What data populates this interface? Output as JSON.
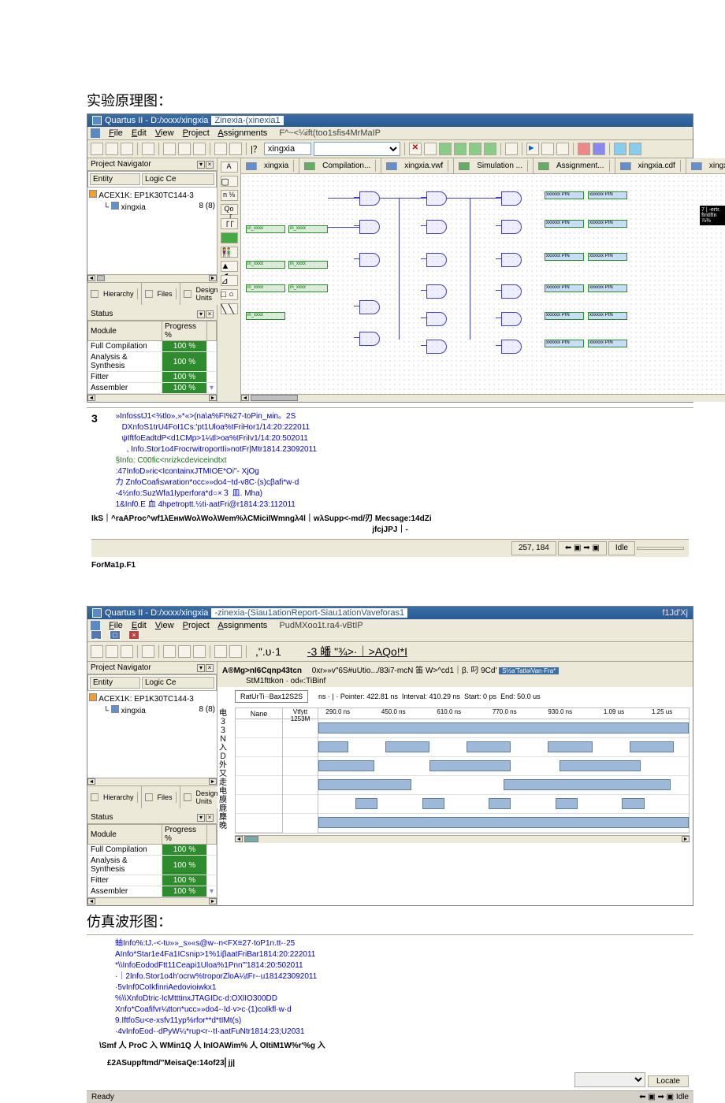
{
  "section1_title": "实验原理图：",
  "section2_title": "仿真波形图：",
  "app": {
    "title1": "Quartus II - D:/xxxx/xingxia",
    "subtitle1": "Zinexia-(xinexia1",
    "info1": "F^~<¼ift(too1sfis4MrMaIP",
    "title2": "Quartus II - D:/xxxx/xingxia",
    "subtitle2": "-zinexia-(Siau1ationReport-Siau1ationVaveforas1",
    "info2": "PudMXoo1t.ra4-vBtIP",
    "corner2": "f1Jd'Xj"
  },
  "menu": {
    "file": "File",
    "edit": "Edit",
    "view": "View",
    "project": "Project",
    "assignments": "Assignments"
  },
  "toolbar": {
    "combo_val": "xingxia"
  },
  "nav": {
    "header": "Project Navigator",
    "col_entity": "Entity",
    "col_logic": "Logic Ce",
    "device": "ACEX1K: EP1K30TC144-3",
    "item": "xingxia",
    "item_val": "8 (8)",
    "tab_hier": "Hierarchy",
    "tab_files": "Files",
    "tab_design": "Design Units",
    "status_hdr": "Status",
    "col_module": "Module",
    "col_progress": "Progress %",
    "rows": [
      {
        "m": "Full Compilation",
        "p": "100 %"
      },
      {
        "m": "Analysis & Synthesis",
        "p": "100 %"
      },
      {
        "m": "Fitter",
        "p": "100 %"
      },
      {
        "m": "Assembler",
        "p": "100 %"
      }
    ]
  },
  "tabs1": [
    {
      "t": "xingxia"
    },
    {
      "t": "Compilation..."
    },
    {
      "t": "xingxia.vwf"
    },
    {
      "t": "Simulation ..."
    },
    {
      "t": "Assignment..."
    },
    {
      "t": "xingxia.cdf"
    },
    {
      "t": "xingxia.cdf"
    }
  ],
  "schematic": {
    "pin_label": "in_xxxx",
    "out_label": "xxxxxx PIN",
    "dark1": "7 | -ertr.",
    "dark2": "fIntIfIn",
    "dark3": "⅞⅜"
  },
  "console1": {
    "big3": "3",
    "lines": [
      "»InfosstJ1<⅜tlo»,»*«>(na\\a%FI%27-toPin_мin。2S",
      "DXnfoS1trU4FoI1Cs:'pt1Uloa%tFriHor1/14:20:222011",
      "ψIftfoEadtdP<d1CMp>1¼tl>oa%tFriIv1/14:20:502011",
      ", Info.Stor1o4FrocrwitroportIi»notFr|Mtr1814.23092011",
      "§Info: C00fic<nrizkcdeviceindtxt",
      ":47InfoD»ric<IcontainxJTMIOE*Oi\"- XjOg",
      "力 ZnfoCoafi≤wration*occ»»do4~td-v8C·(s)cβafi*w·d",
      "-4½nfo:SuzWfa1Iyperfora*d○×３ 皿. Mha)",
      "1&Inf0.E 血 4hpetroptt.½ti·aatFri@r1814:23:112011"
    ],
    "bold": "IkS｜^raAProc^wf1λEнмWoλWoλWem%λCMiciIWmngλ4l｜wλSupp<-md/刃 Meᴄsaɡe:14dZi",
    "jfc": "jfcjJPJ｜-",
    "form": "ForMa1p.F1"
  },
  "statusbar1": {
    "coords": "257, 184",
    "idle": "Idle"
  },
  "win2": {
    "line1": ",\".υ·1",
    "line2": "-3 皤 \"¾>·｜>AQo!*I",
    "line3a": "A®Mg>nI6Cqnp43tcn",
    "line3b": "0xr»»v\"6S#uUtio.../83i7-mcN 笛 W>^cd1｜β. 叼 9Cd'",
    "line4": "StM1fttkon · od«:TiBinf",
    "box": "RatUrTi··Bax12S2S",
    "nane": "Nane",
    "vcol": "Vtfytt 1253M",
    "ptr_lbl": "ns  · | · Pointer:",
    "ptr_v": "422.81 ns",
    "int_lbl": "Interval:",
    "int_v": "410.29 ns",
    "start_lbl": "Start:",
    "start_v": "0 ps",
    "end_lbl": "End:",
    "end_v": "50.0 us",
    "ticks": [
      "290.0 ns",
      "450.0 ns",
      "610.0 ns",
      "770.0 ns",
      "930.0 ns",
      "1.09 us",
      "1.25 us"
    ]
  },
  "console2": {
    "lines": [
      "蚰Info%:tJ.-<-tυ»»_s»«s@w-·n<FX≡27·toP1n.tt-·25",
      "AInfo*Star1e4Fa1ICsnip>1%1iβaatFriBar1814:20:222011",
      "*\\\\InfoEododFtt11Ceapi1Uloa%1Pnn'\"1814:20:502011",
      "·｜2Info.Stor1o4h'ocrw%troporZloA¼tFr-·u181423092011",
      "·5vInf0CoIkfinriAedovioiwkx1",
      "%\\\\XnfoDtric·IcMtttinxJTAGIDc·d:OXlIO300DD",
      "   Xnfo*Coafifvr¼tton*ucc»»do4-·Id·v>c·(1)coIkfl·w·d",
      "9.IftfoSu<e-xsfv11yp%rfor**d*tIMt(s)",
      "·4vInfoEod-·dPyW¼*rup<r-·tI·aatFuNtr1814:23;U2031"
    ],
    "bold": "\\Smf 人 ProC 入 WMin1Q 人 InIOAWim% 人 OItiM1W%r'%g 入",
    "line2": "£2ASuppftmd/\"MeisaQe:14of23⎢jj|"
  },
  "ready": "Ready",
  "idle": "Idle",
  "locate": "Locate"
}
